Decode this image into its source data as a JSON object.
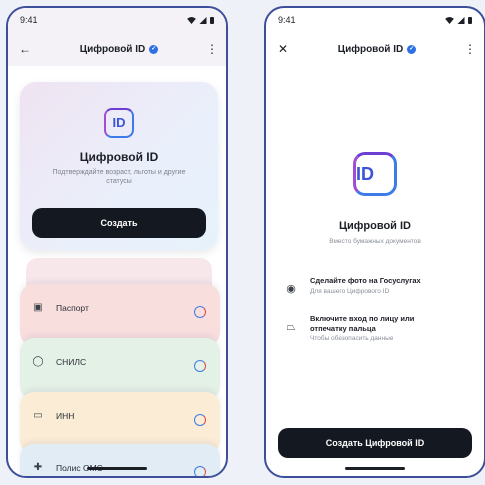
{
  "left": {
    "status": {
      "time": "9:41"
    },
    "header": {
      "title": "Цифровой ID"
    },
    "card": {
      "logo_text": "ID",
      "title": "Цифровой ID",
      "subtitle": "Подтверждайте возраст, льготы и другие статусы",
      "button": "Создать"
    },
    "documents": [
      {
        "label": "Паспорт",
        "color": "#f9dede",
        "icon": "passport-icon"
      },
      {
        "label": "СНИЛС",
        "color": "#e4f1e6",
        "icon": "shield-icon"
      },
      {
        "label": "ИНН",
        "color": "#fbecd6",
        "icon": "card-icon"
      },
      {
        "label": "Полис ОМС",
        "color": "#e1ecf5",
        "icon": "medical-cross-icon"
      }
    ]
  },
  "right": {
    "status": {
      "time": "9:41"
    },
    "header": {
      "title": "Цифровой ID"
    },
    "logo_text": "ID",
    "title": "Цифровой ID",
    "subtitle": "Вместо бумажных документов",
    "steps": [
      {
        "title": "Сделайте фото на Госуслугах",
        "subtitle": "Для вашего Цифрового ID",
        "icon": "camera-icon"
      },
      {
        "title": "Включите вход по лицу или отпечатку пальца",
        "subtitle": "Чтобы обезопасить данные",
        "icon": "face-scan-icon"
      }
    ],
    "button": "Создать Цифровой ID"
  },
  "colors": {
    "accent": "#2f6fe4",
    "dark_button": "#141821",
    "frame": "#3d4f9a"
  }
}
